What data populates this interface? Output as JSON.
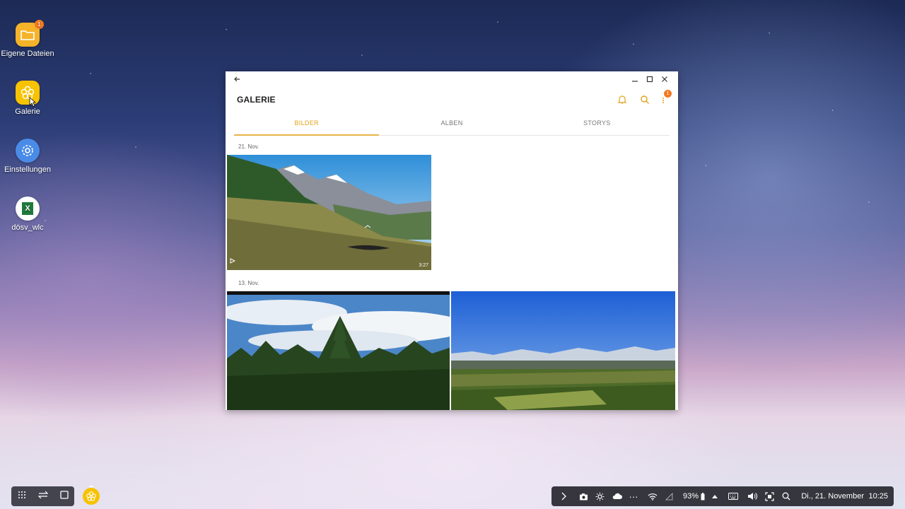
{
  "desktop": {
    "icons": [
      {
        "label": "Eigene Dateien",
        "icon": "folder-icon",
        "badge": "1"
      },
      {
        "label": "Galerie",
        "icon": "gallery-flower-icon"
      },
      {
        "label": "Einstellungen",
        "icon": "gear-icon"
      },
      {
        "label": "dösv_wlc",
        "icon": "excel-icon"
      }
    ]
  },
  "window": {
    "app_title": "GALERIE",
    "more_badge": "1",
    "tabs": [
      {
        "label": "BILDER",
        "active": true
      },
      {
        "label": "ALBEN",
        "active": false
      },
      {
        "label": "STORYS",
        "active": false
      }
    ],
    "groups": [
      {
        "date": "21. Nov.",
        "items": [
          {
            "type": "video",
            "duration": "3:27"
          }
        ]
      },
      {
        "date": "13. Nov.",
        "items": [
          {
            "type": "image"
          },
          {
            "type": "image"
          }
        ]
      }
    ]
  },
  "taskbar": {
    "battery": "93%",
    "datetime": "Di., 21. November",
    "time": "10:25"
  },
  "colors": {
    "accent": "#e3a21a",
    "badge": "#f47a1f"
  }
}
